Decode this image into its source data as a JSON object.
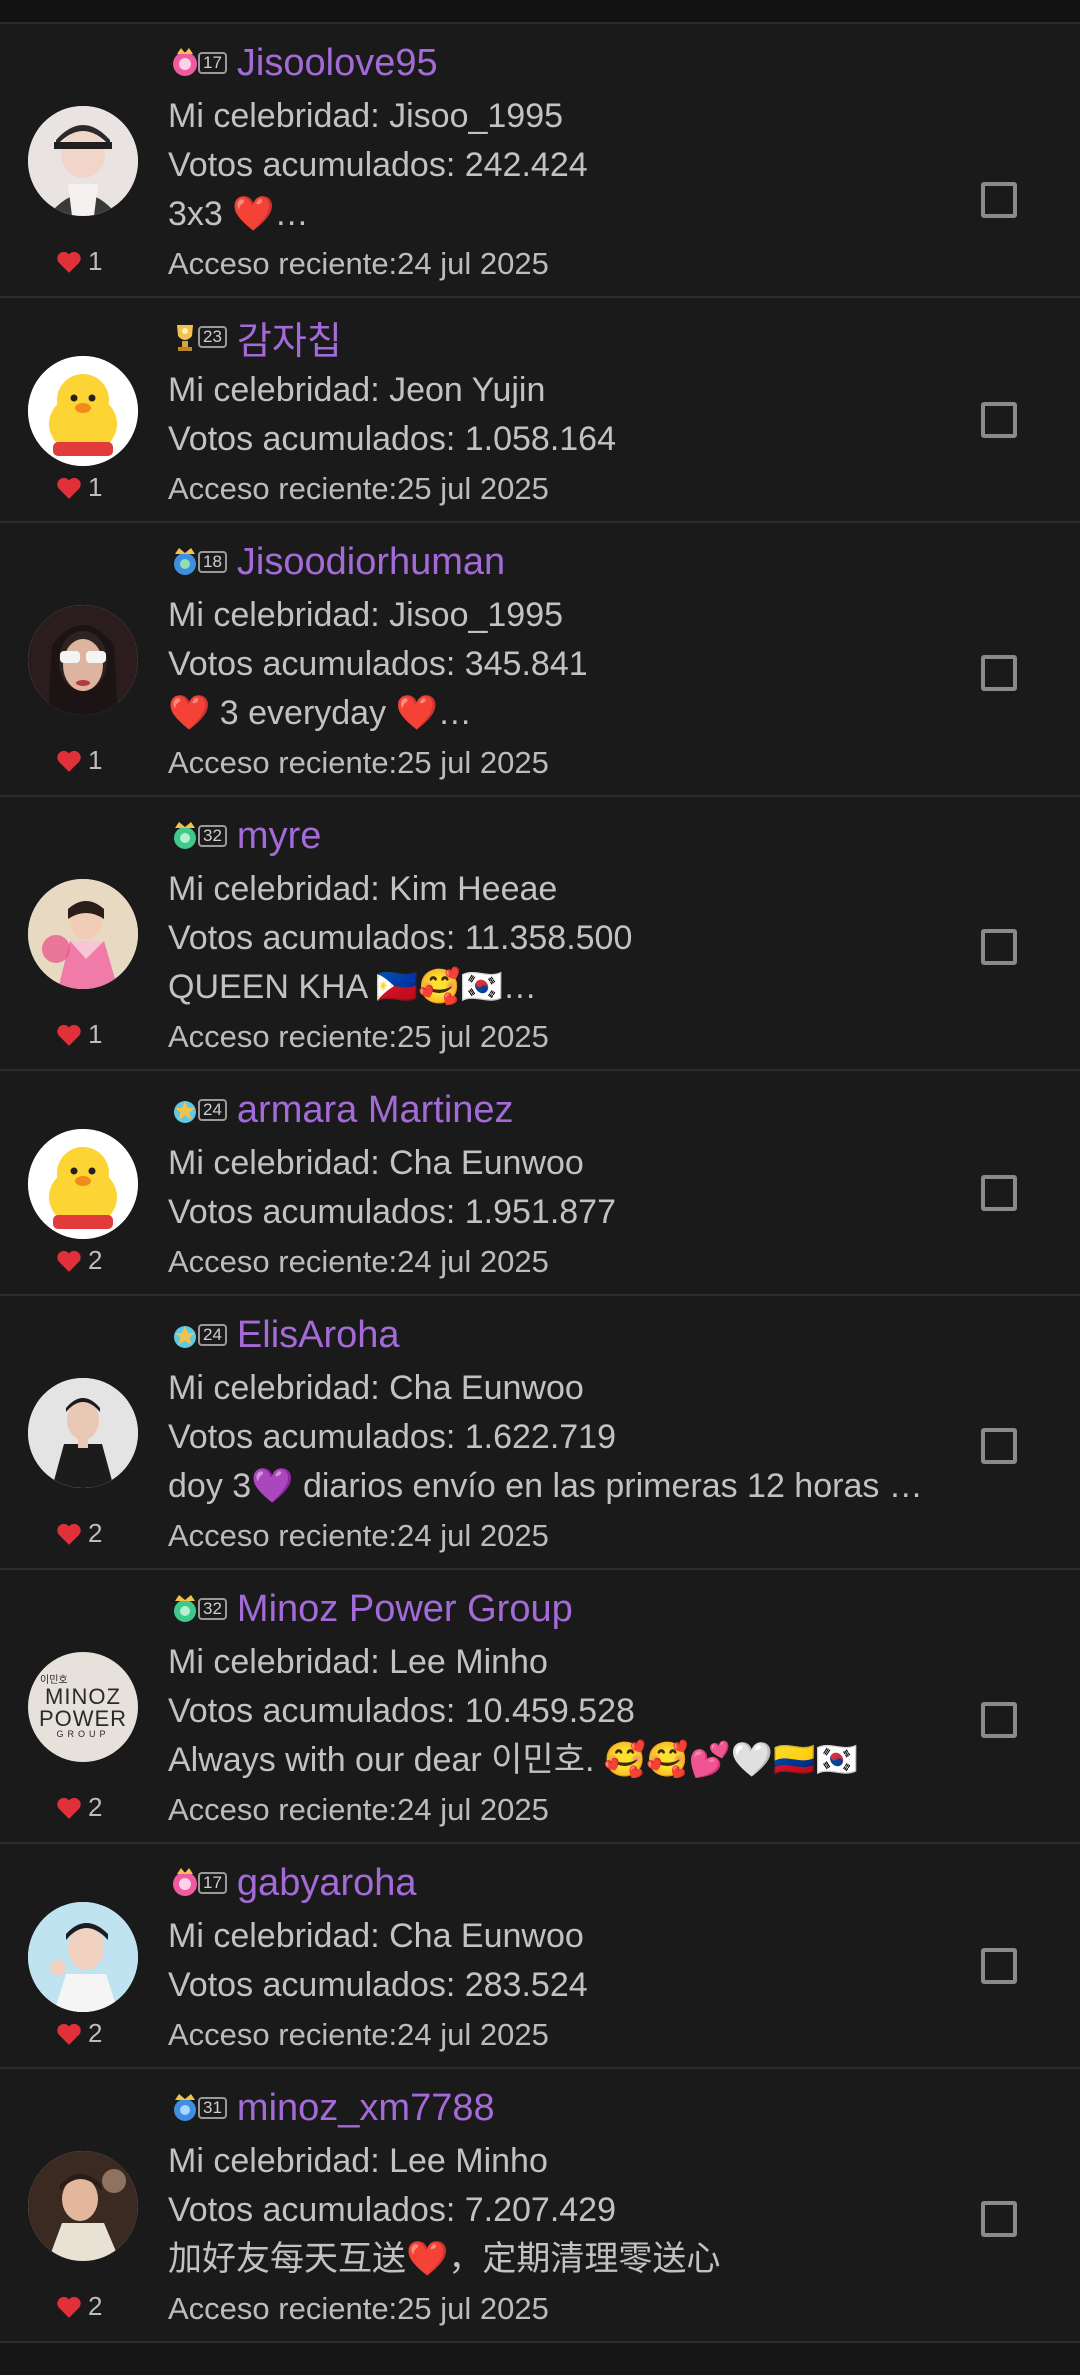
{
  "labels": {
    "celebrity_prefix": "Mi celebridad: ",
    "votes_prefix": "Votos acumulados: ",
    "access_prefix": "Acceso reciente:"
  },
  "users": [
    {
      "badge_level": "17",
      "badge_icon": "pink-flower-badge",
      "username": "Jisoolove95",
      "likes": "1",
      "celebrity": "Mi celebridad: Jisoo_1995",
      "votes": "Votos acumulados: 242.424",
      "message": "3x3 ❤️…",
      "access": "Acceso reciente:24 jul 2025",
      "avatar_icon": "avatar-photo-woman"
    },
    {
      "badge_level": "23",
      "badge_icon": "gold-trophy-badge",
      "username": "감자칩",
      "likes": "1",
      "celebrity": "Mi celebridad: Jeon Yujin",
      "votes": "Votos acumulados: 1.058.164",
      "message": "",
      "access": "Acceso reciente:25 jul 2025",
      "avatar_icon": "yellow-chick-avatar"
    },
    {
      "badge_level": "18",
      "badge_icon": "blue-crown-badge",
      "username": "Jisoodiorhuman",
      "likes": "1",
      "celebrity": "Mi celebridad: Jisoo_1995",
      "votes": "Votos acumulados: 345.841",
      "message": "❤️ 3 everyday ❤️…",
      "access": "Acceso reciente:25 jul 2025",
      "avatar_icon": "avatar-photo-sunglasses"
    },
    {
      "badge_level": "32",
      "badge_icon": "green-crown-badge",
      "username": "myre",
      "likes": "1",
      "celebrity": "Mi celebridad: Kim Heeae",
      "votes": "Votos acumulados: 11.358.500",
      "message": "QUEEN KHA 🇵🇭🥰🇰🇷…",
      "access": "Acceso reciente:25 jul 2025",
      "avatar_icon": "avatar-photo-hanbok"
    },
    {
      "badge_level": "24",
      "badge_icon": "star-badge",
      "username": "armara Martinez",
      "likes": "2",
      "celebrity": "Mi celebridad: Cha Eunwoo",
      "votes": "Votos acumulados: 1.951.877",
      "message": "",
      "access": "Acceso reciente:24 jul 2025",
      "avatar_icon": "yellow-chick-avatar"
    },
    {
      "badge_level": "24",
      "badge_icon": "star-badge",
      "username": "ElisAroha",
      "likes": "2",
      "celebrity": "Mi celebridad: Cha Eunwoo",
      "votes": "Votos acumulados: 1.622.719",
      "message": "doy 3💜 diarios  envío en las primeras 12 horas …",
      "access": "Acceso reciente:24 jul 2025",
      "avatar_icon": "avatar-photo-man"
    },
    {
      "badge_level": "32",
      "badge_icon": "green-crown-badge",
      "username": "Minoz Power Group",
      "likes": "2",
      "celebrity": "Mi celebridad: Lee Minho",
      "votes": "Votos acumulados: 10.459.528",
      "message": "Always with our dear 이민호. 🥰🥰💕🤍🇨🇴🇰🇷",
      "access": "Acceso reciente:24 jul 2025",
      "avatar_icon": "minoz-power-group-logo",
      "avatar_logo": {
        "line1": "이민호",
        "line2": "MINOZ",
        "line3": "POWER",
        "line4": "GROUP"
      }
    },
    {
      "badge_level": "17",
      "badge_icon": "pink-flower-badge",
      "username": "gabyaroha",
      "likes": "2",
      "celebrity": "Mi celebridad: Cha Eunwoo",
      "votes": "Votos acumulados: 283.524",
      "message": "",
      "access": "Acceso reciente:24 jul 2025",
      "avatar_icon": "avatar-photo-man-blue"
    },
    {
      "badge_level": "31",
      "badge_icon": "blue-crown-badge",
      "username": "minoz_xm7788",
      "likes": "2",
      "celebrity": "Mi celebridad: Lee Minho",
      "votes": "Votos acumulados: 7.207.429",
      "message": "加好友每天互送❤️，定期清理零送心",
      "access": "Acceso reciente:25 jul 2025",
      "avatar_icon": "avatar-photo-man-smile"
    }
  ],
  "colors": {
    "background": "#1a1a1a",
    "username": "#a46bd8",
    "text": "#c2c2c2",
    "heart": "#e0303a",
    "checkbox": "#8a8a8a"
  }
}
